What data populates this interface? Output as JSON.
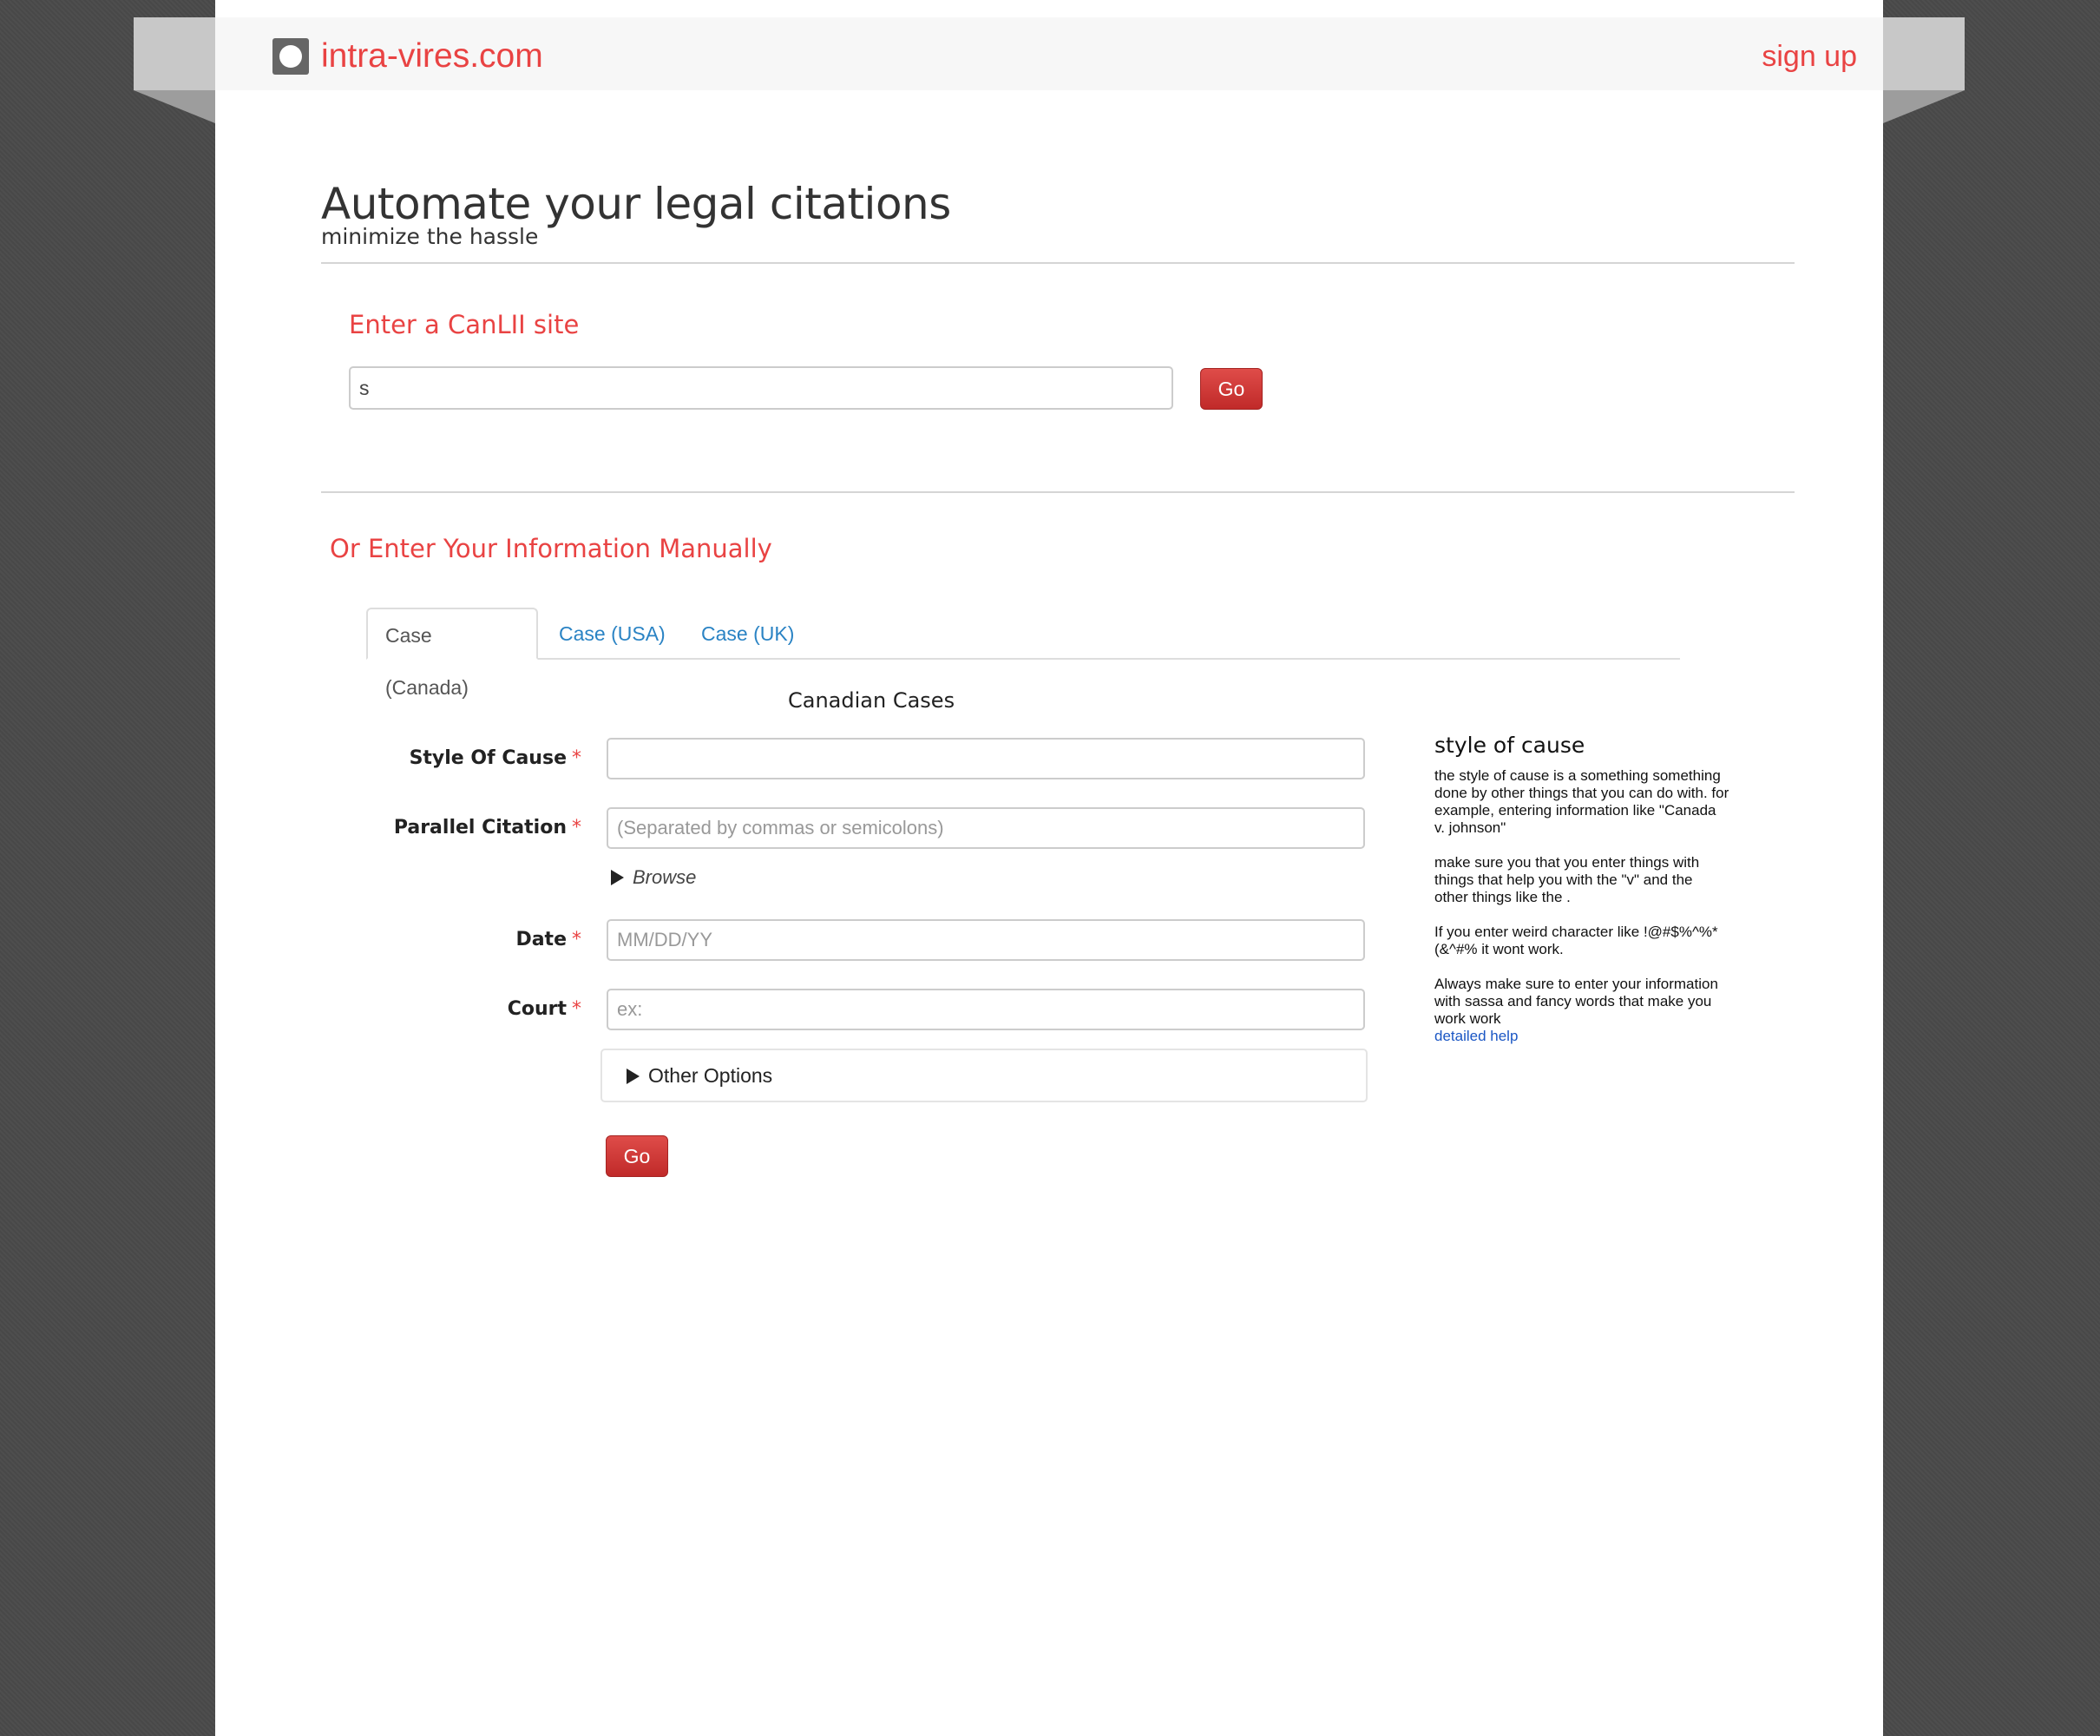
{
  "site": {
    "name": "intra-vires.com",
    "signup_label": "sign up"
  },
  "hero": {
    "title": "Automate your legal citations",
    "subtitle": "minimize the hassle"
  },
  "canlii": {
    "heading": "Enter a CanLII site",
    "input_value": "s",
    "go_label": "Go"
  },
  "manual": {
    "heading": "Or Enter Your Information Manually",
    "tabs": [
      {
        "label": "Case (Canada)",
        "active": true
      },
      {
        "label": "Case (USA)",
        "active": false
      },
      {
        "label": "Case (UK)",
        "active": false
      }
    ],
    "form_title": "Canadian Cases",
    "required_marker": "*",
    "fields": {
      "style_of_cause": {
        "label": "Style Of Cause",
        "value": "",
        "placeholder": ""
      },
      "parallel_citation": {
        "label": "Parallel Citation",
        "value": "",
        "placeholder": "(Separated by commas or semicolons)"
      },
      "date": {
        "label": "Date",
        "value": "",
        "placeholder": "MM/DD/YY"
      },
      "court": {
        "label": "Court",
        "value": "",
        "placeholder": "ex:"
      }
    },
    "browse_label": "Browse",
    "other_options_label": "Other Options",
    "go_label": "Go"
  },
  "help": {
    "title": "style of cause",
    "paragraphs": [
      "the style of cause is a something something done by other things that you can do with. for example, entering information like \"Canada v. johnson\"",
      "make sure you that you enter things with things that help you with the \"v\" and the other things like the .",
      "If you enter weird character like !@#$%^%*(&^#% it wont work.",
      "Always make sure to enter your information with sassa and fancy words that make you work work"
    ],
    "link_label": "detailed help"
  },
  "colors": {
    "accent": "#e94343",
    "link": "#2a83c4",
    "background": "#4a4a4a"
  }
}
